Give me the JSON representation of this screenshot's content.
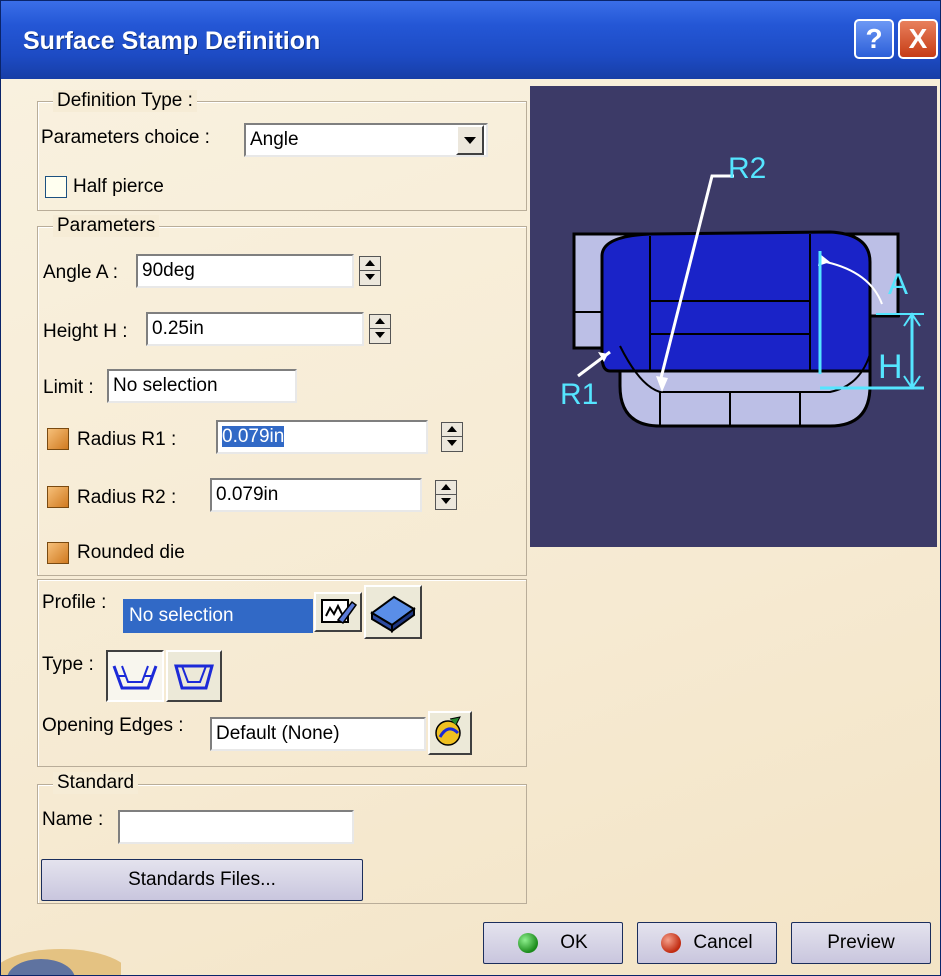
{
  "window": {
    "title": "Surface Stamp Definition",
    "help_glyph": "?",
    "close_glyph": "X"
  },
  "definition_type": {
    "legend": "Definition Type :",
    "parameters_choice_label": "Parameters choice :",
    "parameters_choice_value": "Angle",
    "half_pierce_label": "Half pierce",
    "half_pierce_checked": false
  },
  "parameters": {
    "legend": "Parameters",
    "angle_label": "Angle A :",
    "angle_value": "90deg",
    "height_label": "Height H :",
    "height_value": "0.25in",
    "limit_label": "Limit :",
    "limit_value": "No selection",
    "radius_r1_label": "Radius R1 :",
    "radius_r1_value": "0.079in",
    "radius_r1_checked": true,
    "radius_r2_label": "Radius R2 :",
    "radius_r2_value": "0.079in",
    "radius_r2_checked": true,
    "rounded_die_label": "Rounded die",
    "rounded_die_checked": true
  },
  "profile": {
    "profile_label": "Profile :",
    "profile_value": "No selection",
    "type_label": "Type :",
    "opening_edges_label": "Opening Edges :",
    "opening_edges_value": "Default (None)"
  },
  "standard": {
    "legend": "Standard",
    "name_label": "Name :",
    "name_value": "",
    "standards_files_button": "Standards Files..."
  },
  "preview": {
    "label_r2": "R2",
    "label_r1": "R1",
    "label_a": "A",
    "label_h": "H"
  },
  "buttons": {
    "ok": "OK",
    "cancel": "Cancel",
    "preview": "Preview"
  },
  "colors": {
    "title_bar": "#2457d6",
    "dialog_bg": "#f6ecd6",
    "preview_bg": "#3c3a67",
    "accent_cyan": "#55e5ff",
    "part_blue": "#1a23c8"
  }
}
